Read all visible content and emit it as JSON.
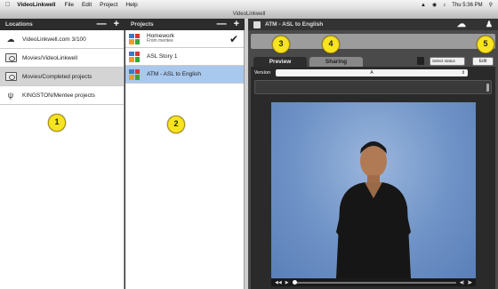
{
  "menubar": {
    "app": "VideoLinkwell",
    "items": [
      "File",
      "Edit",
      "Project",
      "Help"
    ],
    "clock": "Thu 5:36 PM"
  },
  "window": {
    "title": "VideoLinkwell"
  },
  "locations": {
    "header": "Locations",
    "items": [
      {
        "label": "VideoLinkwell.com 3/100",
        "icon": "cloud-icon"
      },
      {
        "label": "Movies/VideoLinkwell",
        "icon": "drive-icon"
      },
      {
        "label": "Movies/Completed projects",
        "icon": "drive-icon",
        "selected": true
      },
      {
        "label": "KINGSTON/Mentee projects",
        "icon": "usb-icon"
      }
    ]
  },
  "projects": {
    "header": "Projects",
    "items": [
      {
        "title": "Homework",
        "subtitle": "From mentee",
        "checked": true
      },
      {
        "title": "ASL Story 1"
      },
      {
        "title": "ATM - ASL to English",
        "selected": true
      }
    ]
  },
  "main": {
    "title": "ATM - ASL to English",
    "tabs": [
      "Preview",
      "Sharing"
    ],
    "status_select": "Select status",
    "edit_label": "Edit",
    "version_label": "Version",
    "version_value": "A"
  },
  "callouts": [
    "1",
    "2",
    "3",
    "4",
    "5"
  ],
  "colors": {
    "accent_selected": "#a9c8ee",
    "callout": "#f7e421",
    "video_bg": "#6f93c7"
  }
}
